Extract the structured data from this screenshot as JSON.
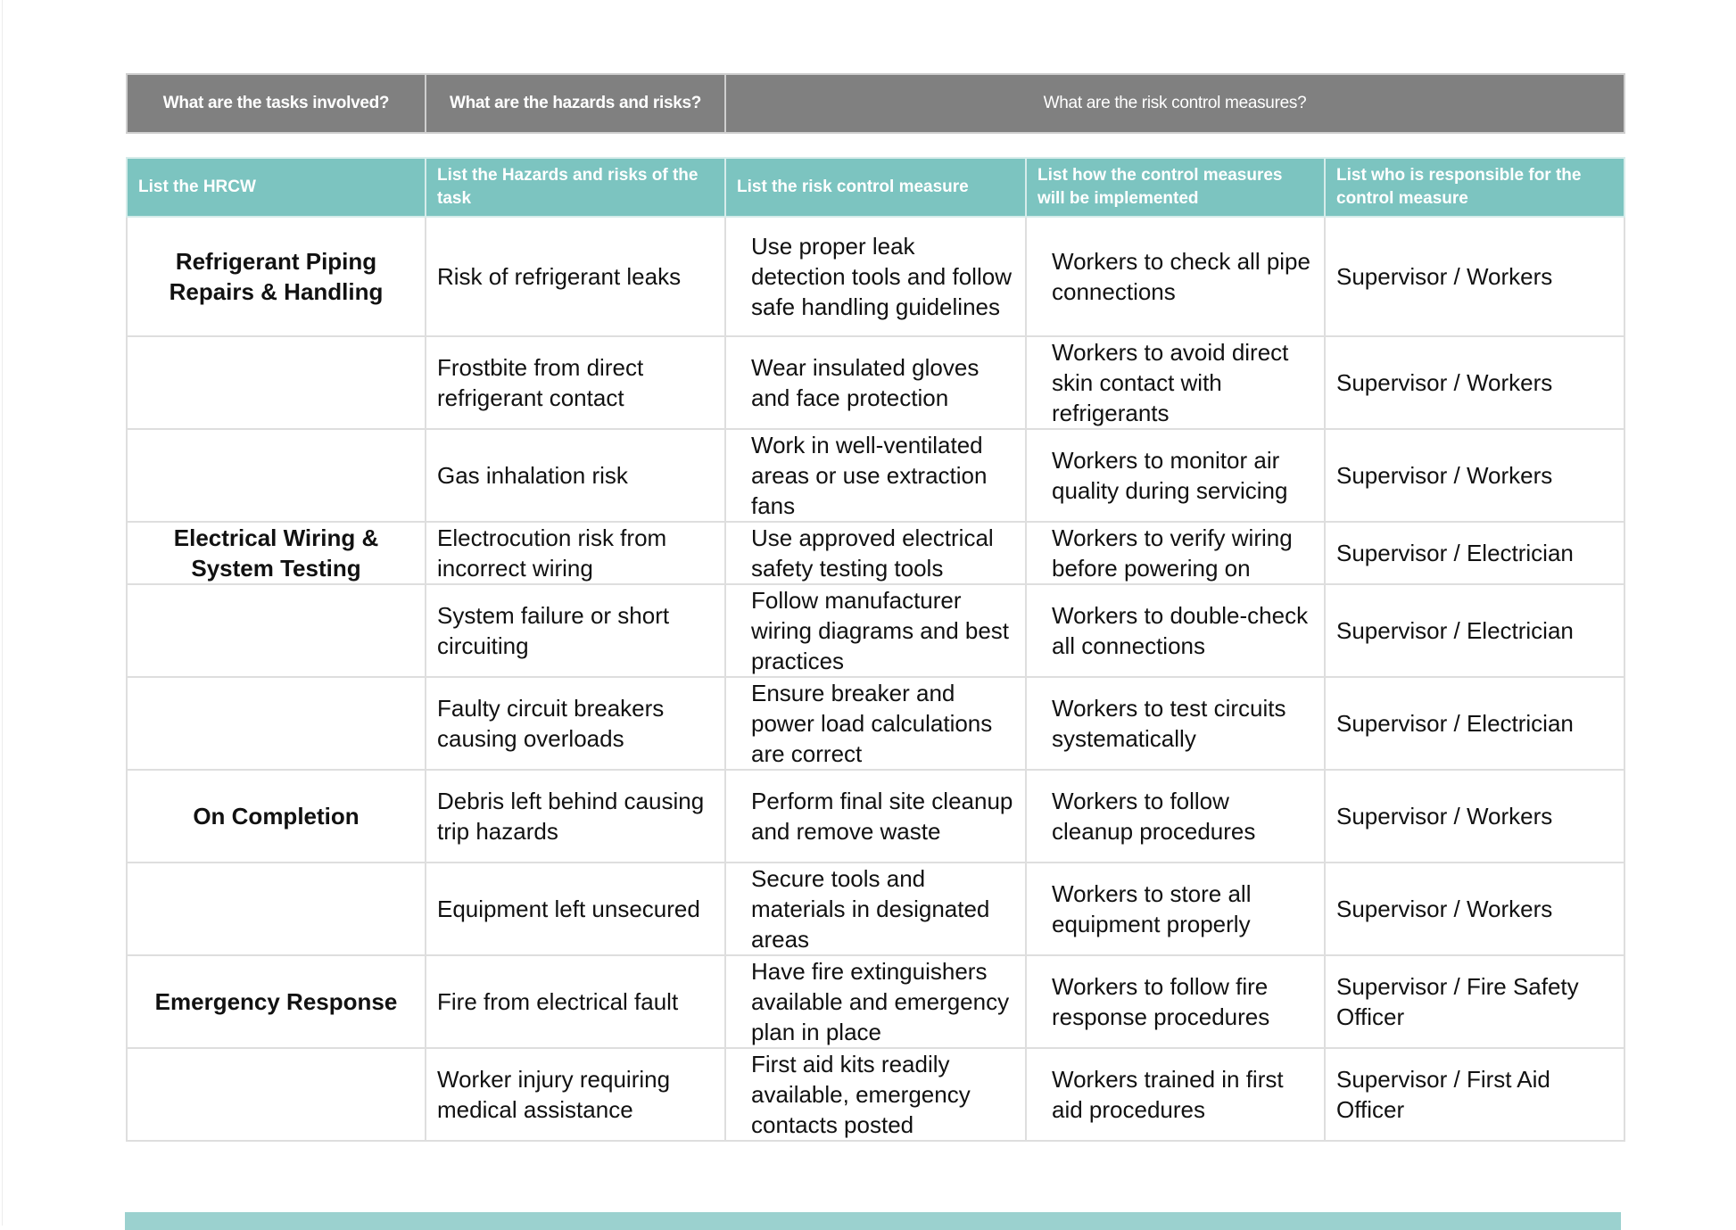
{
  "top_header": {
    "tasks": "What are the tasks involved?",
    "hazards": "What are the hazards and risks?",
    "controls": "What are the risk control measures?"
  },
  "column_headers": [
    "List the HRCW",
    "List the Hazards and risks of the task",
    "List the risk control measure",
    "List how the control measures will be implemented",
    "List who is responsible for the control measure"
  ],
  "rows": [
    {
      "task": "Refrigerant Piping Repairs & Handling",
      "hazard": "Risk of refrigerant leaks",
      "control": "Use proper leak detection tools and follow safe handling guidelines",
      "implementation": "Workers to check all pipe connections",
      "responsible": "Supervisor / Workers"
    },
    {
      "task": "",
      "hazard": "Frostbite from direct refrigerant contact",
      "control": "Wear insulated gloves and face protection",
      "implementation": "Workers to avoid direct skin contact with refrigerants",
      "responsible": "Supervisor / Workers"
    },
    {
      "task": "",
      "hazard": "Gas inhalation risk",
      "control": "Work in well-ventilated areas or use extraction fans",
      "implementation": "Workers to monitor air quality during servicing",
      "responsible": "Supervisor / Workers"
    },
    {
      "task": "Electrical Wiring & System Testing",
      "hazard": "Electrocution risk from incorrect wiring",
      "control": "Use approved electrical safety testing tools",
      "implementation": "Workers to verify wiring before powering on",
      "responsible": "Supervisor / Electrician"
    },
    {
      "task": "",
      "hazard": "System failure or short circuiting",
      "control": "Follow manufacturer wiring diagrams and best practices",
      "implementation": "Workers to double-check all connections",
      "responsible": "Supervisor / Electrician"
    },
    {
      "task": "",
      "hazard": "Faulty circuit breakers causing overloads",
      "control": "Ensure breaker and power load calculations are correct",
      "implementation": "Workers to test circuits systematically",
      "responsible": "Supervisor / Electrician"
    },
    {
      "task": "On Completion",
      "hazard": "Debris left behind causing trip hazards",
      "control": "Perform final site cleanup and remove waste",
      "implementation": "Workers to follow cleanup procedures",
      "responsible": "Supervisor / Workers"
    },
    {
      "task": "",
      "hazard": "Equipment left unsecured",
      "control": "Secure tools and materials in designated areas",
      "implementation": "Workers to store all equipment properly",
      "responsible": "Supervisor / Workers"
    },
    {
      "task": "Emergency Response",
      "hazard": "Fire from electrical fault",
      "control": "Have fire extinguishers available and emergency plan in place",
      "implementation": "Workers to follow fire response procedures",
      "responsible": "Supervisor / Fire Safety Officer"
    },
    {
      "task": "",
      "hazard": "Worker injury requiring medical assistance",
      "control": "First aid kits readily available, emergency contacts posted",
      "implementation": "Workers trained in first aid procedures",
      "responsible": "Supervisor / First Aid Officer"
    }
  ],
  "colors": {
    "grey_header": "#808080",
    "teal_header": "#7cc4c0",
    "footer_band": "#9bd1cf"
  }
}
